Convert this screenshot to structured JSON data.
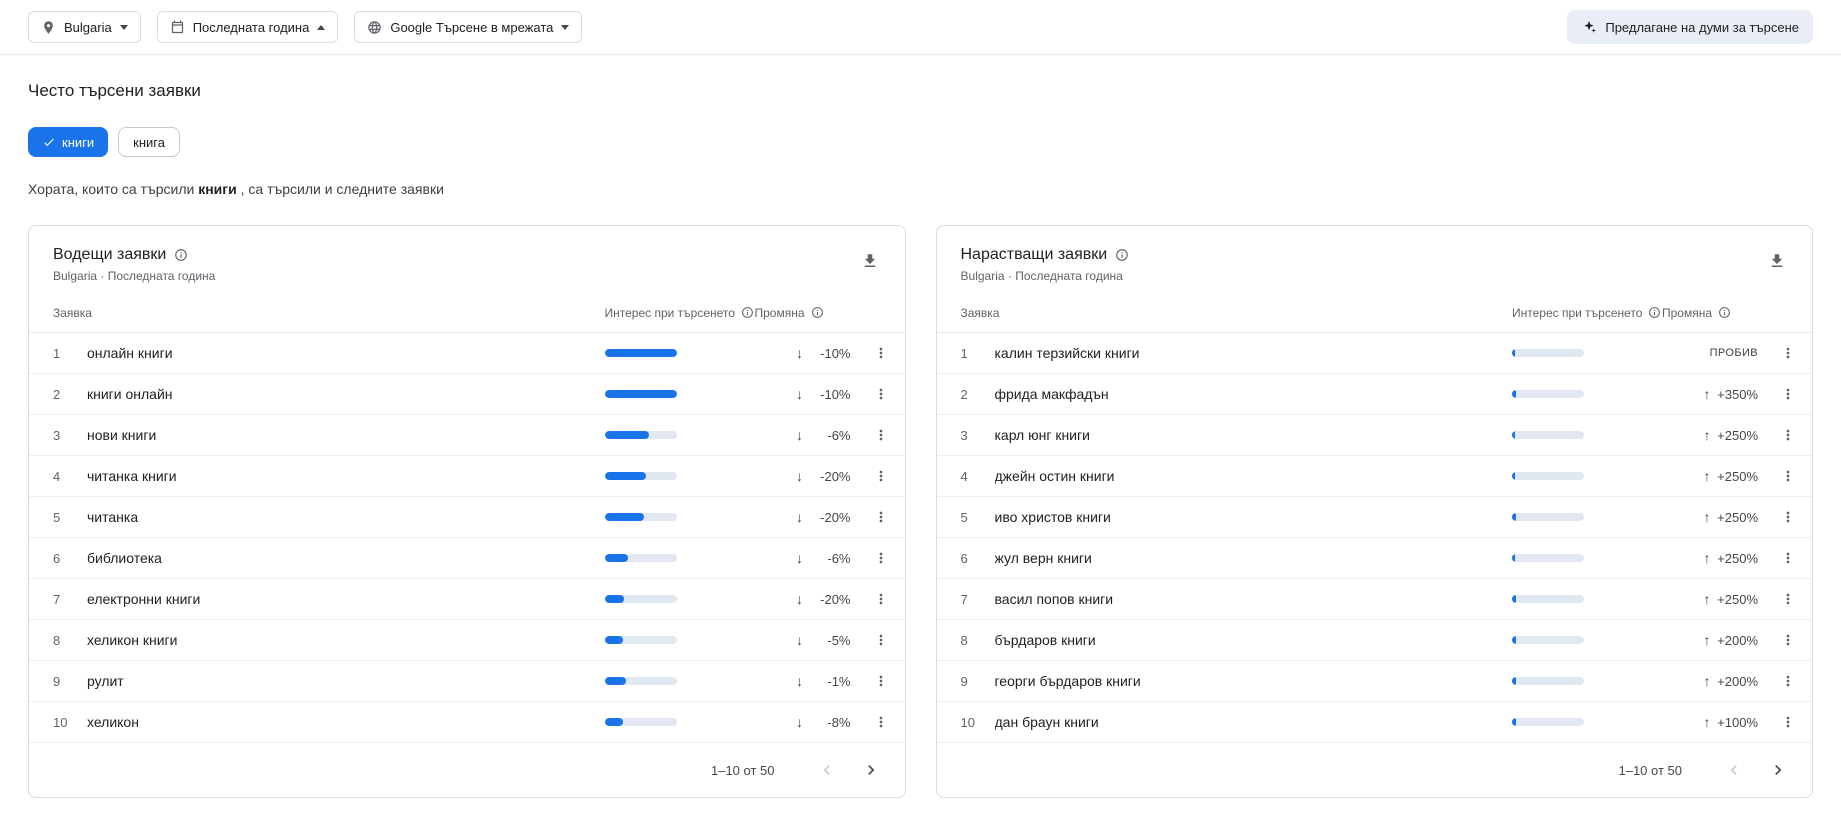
{
  "topbar": {
    "filters": [
      {
        "label": "Bulgaria",
        "icon": "location-pin-icon",
        "caret": "down"
      },
      {
        "label": "Последната година",
        "icon": "calendar-icon",
        "caret": "up"
      },
      {
        "label": "Google Търсене в мрежата",
        "icon": "globe-icon",
        "caret": "down"
      }
    ],
    "suggest_button_label": "Предлагане на думи за търсене"
  },
  "page_title": "Често търсени заявки",
  "chips": [
    {
      "label": "книги",
      "selected": true
    },
    {
      "label": "книга",
      "selected": false
    }
  ],
  "description": {
    "prefix": "Хората, които са търсили ",
    "term": "книги",
    "suffix": " , са търсили и следните заявки"
  },
  "columns": {
    "query": "Заявка",
    "interest": "Интерес при търсенето",
    "change": "Промяна"
  },
  "cards": [
    {
      "title": "Водещи заявки",
      "subtitle": "Bulgaria · Последната година",
      "pagination": "1–10 от 50",
      "rows": [
        {
          "rank": 1,
          "query": "онлайн книги",
          "interest": 100,
          "direction": "down",
          "change": "-10%"
        },
        {
          "rank": 2,
          "query": "книги онлайн",
          "interest": 100,
          "direction": "down",
          "change": "-10%"
        },
        {
          "rank": 3,
          "query": "нови книги",
          "interest": 62,
          "direction": "down",
          "change": "-6%"
        },
        {
          "rank": 4,
          "query": "читанка книги",
          "interest": 58,
          "direction": "down",
          "change": "-20%"
        },
        {
          "rank": 5,
          "query": "читанка",
          "interest": 55,
          "direction": "down",
          "change": "-20%"
        },
        {
          "rank": 6,
          "query": "библиотека",
          "interest": 32,
          "direction": "down",
          "change": "-6%"
        },
        {
          "rank": 7,
          "query": "електронни книги",
          "interest": 27,
          "direction": "down",
          "change": "-20%"
        },
        {
          "rank": 8,
          "query": "хеликон книги",
          "interest": 26,
          "direction": "down",
          "change": "-5%"
        },
        {
          "rank": 9,
          "query": "рулит",
          "interest": 30,
          "direction": "down",
          "change": "-1%"
        },
        {
          "rank": 10,
          "query": "хеликон",
          "interest": 26,
          "direction": "down",
          "change": "-8%"
        }
      ]
    },
    {
      "title": "Нарастващи заявки",
      "subtitle": "Bulgaria · Последната година",
      "pagination": "1–10 от 50",
      "rows": [
        {
          "rank": 1,
          "query": "калин терзийски книги",
          "interest": 4,
          "direction": "none",
          "change": "ПРОБИВ"
        },
        {
          "rank": 2,
          "query": "фрида макфадън",
          "interest": 6,
          "direction": "up",
          "change": "+350%"
        },
        {
          "rank": 3,
          "query": "карл юнг книги",
          "interest": 4,
          "direction": "up",
          "change": "+250%"
        },
        {
          "rank": 4,
          "query": "джейн остин книги",
          "interest": 4,
          "direction": "up",
          "change": "+250%"
        },
        {
          "rank": 5,
          "query": "иво христов книги",
          "interest": 5,
          "direction": "up",
          "change": "+250%"
        },
        {
          "rank": 6,
          "query": "жул верн книги",
          "interest": 4,
          "direction": "up",
          "change": "+250%"
        },
        {
          "rank": 7,
          "query": "васил попов книги",
          "interest": 5,
          "direction": "up",
          "change": "+250%"
        },
        {
          "rank": 8,
          "query": "бърдаров книги",
          "interest": 5,
          "direction": "up",
          "change": "+200%"
        },
        {
          "rank": 9,
          "query": "георги бърдаров книги",
          "interest": 5,
          "direction": "up",
          "change": "+200%"
        },
        {
          "rank": 10,
          "query": "дан браун книги",
          "interest": 6,
          "direction": "up",
          "change": "+100%"
        }
      ]
    }
  ],
  "icons": {
    "change_down": "↓",
    "change_up": "↑"
  },
  "colors": {
    "accent": "#1a73e8",
    "bar_fill": "#1a73e8",
    "bar_track": "#e2e8f2",
    "text_primary": "#202124",
    "text_secondary": "#5f6368",
    "border": "#dadce0",
    "suggest_bg": "#e9eef6"
  }
}
